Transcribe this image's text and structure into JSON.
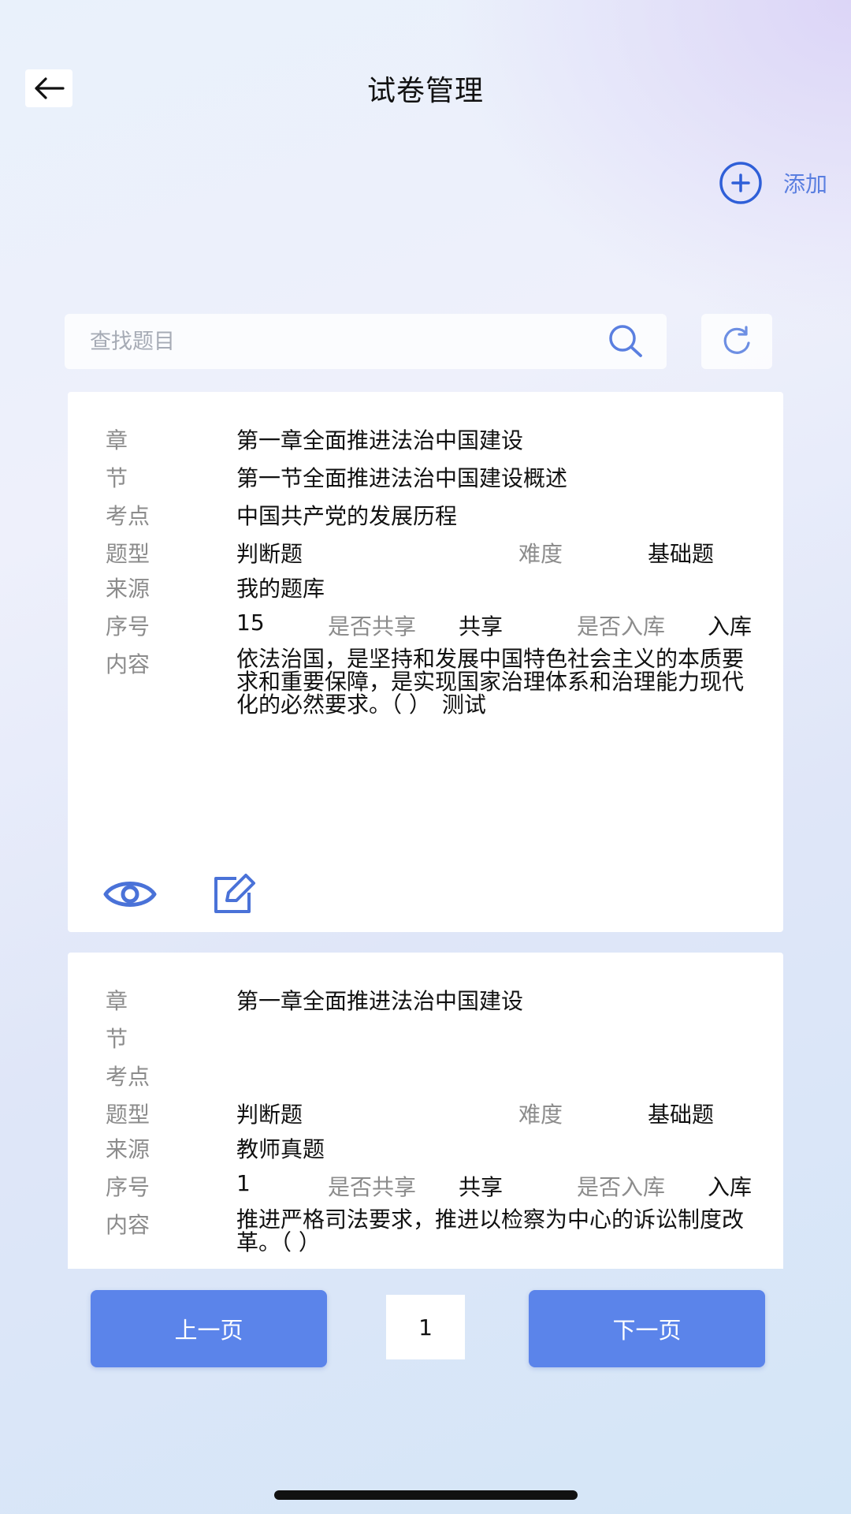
{
  "header": {
    "title": "试卷管理",
    "add_label": "添加"
  },
  "search": {
    "placeholder": "查找题目"
  },
  "labels": {
    "chapter": "章",
    "section": "节",
    "point": "考点",
    "type": "题型",
    "difficulty": "难度",
    "source": "来源",
    "seq": "序号",
    "shared": "是否共享",
    "stored": "是否入库",
    "content": "内容"
  },
  "cards": [
    {
      "chapter": "第一章全面推进法治中国建设",
      "section": "第一节全面推进法治中国建设概述",
      "point": "中国共产党的发展历程",
      "type": "判断题",
      "difficulty": "基础题",
      "source": "我的题库",
      "seq": "15",
      "shared": "共享",
      "stored": "入库",
      "content": "依法治国，是坚持和发展中国特色社会主义的本质要求和重要保障，是实现国家治理体系和治理能力现代化的必然要求。（ ）　测试"
    },
    {
      "chapter": "第一章全面推进法治中国建设",
      "section": "",
      "point": "",
      "type": "判断题",
      "difficulty": "基础题",
      "source": "教师真题",
      "seq": "1",
      "shared": "共享",
      "stored": "入库",
      "content": "推进严格司法要求，推进以检察为中心的诉讼制度改革。（ ）"
    }
  ],
  "pager": {
    "prev_label": "上一页",
    "next_label": "下一页",
    "current_page": "1"
  },
  "colors": {
    "accent": "#5b84ea",
    "link": "#5a7fe0",
    "icon": "#4a72d8",
    "label": "#8c8c8c"
  },
  "icons": {
    "back": "arrow-left-icon",
    "add": "plus-circle-icon",
    "search": "search-icon",
    "refresh": "refresh-icon",
    "view": "eye-icon",
    "edit": "edit-icon"
  }
}
